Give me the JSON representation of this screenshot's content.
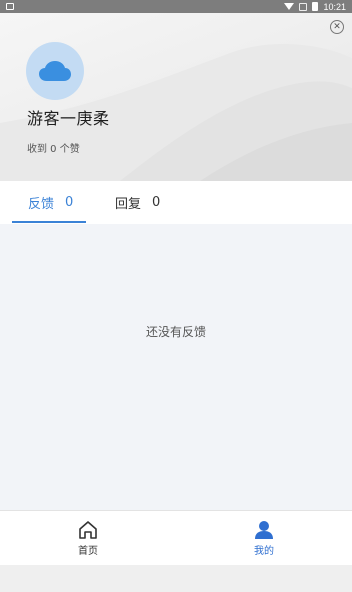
{
  "status_bar": {
    "time": "10:21"
  },
  "profile": {
    "username": "游客一庚柔",
    "likes_text": "收到 0 个赞",
    "avatar_color": "#c3dbf3",
    "avatar_icon": "cloud-icon"
  },
  "tabs": [
    {
      "label": "反馈",
      "count": "0",
      "active": true
    },
    {
      "label": "回复",
      "count": "0",
      "active": false
    }
  ],
  "content": {
    "empty_text": "还没有反馈"
  },
  "bottom_nav": [
    {
      "label": "首页",
      "icon": "home-icon",
      "active": false
    },
    {
      "label": "我的",
      "icon": "user-icon",
      "active": true
    }
  ],
  "colors": {
    "accent": "#3b82d6",
    "background": "#f2f4f8"
  }
}
